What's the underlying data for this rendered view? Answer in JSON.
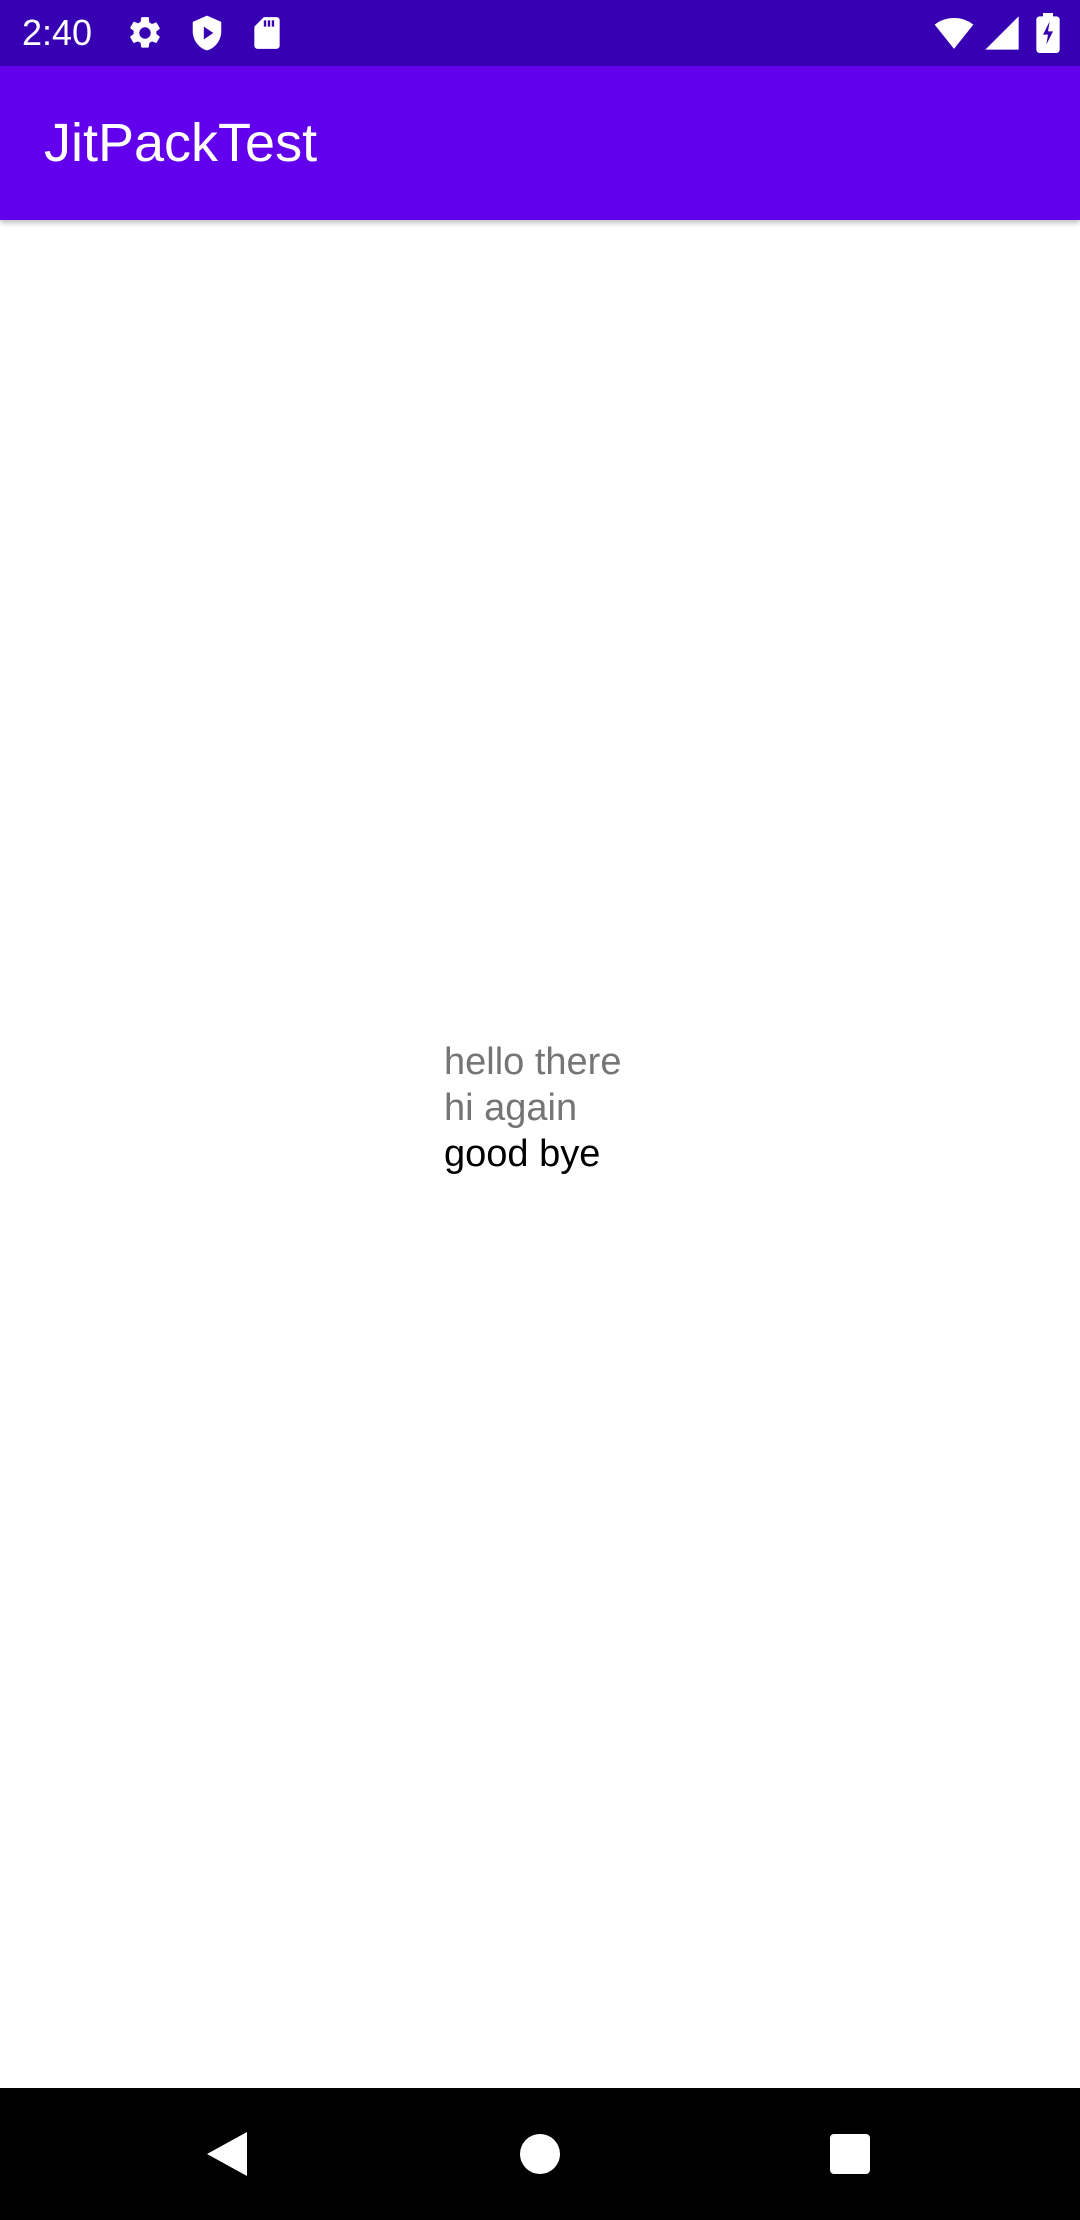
{
  "status_bar": {
    "time": "2:40",
    "background_color": "#3700b3",
    "left_icons": [
      "settings-gear-icon",
      "play-protect-shield-icon",
      "sd-card-icon"
    ],
    "right_icons": [
      "wifi-icon",
      "cell-signal-icon",
      "battery-icon"
    ]
  },
  "app_bar": {
    "title": "JitPackTest",
    "background_color": "#6200ee"
  },
  "content": {
    "lines": [
      {
        "text": "hello there",
        "color": "#757575"
      },
      {
        "text": "hi again",
        "color": "#757575"
      },
      {
        "text": "good bye",
        "color": "#000000"
      }
    ]
  },
  "nav_bar": {
    "buttons": [
      "back-icon",
      "home-icon",
      "recents-icon"
    ]
  }
}
